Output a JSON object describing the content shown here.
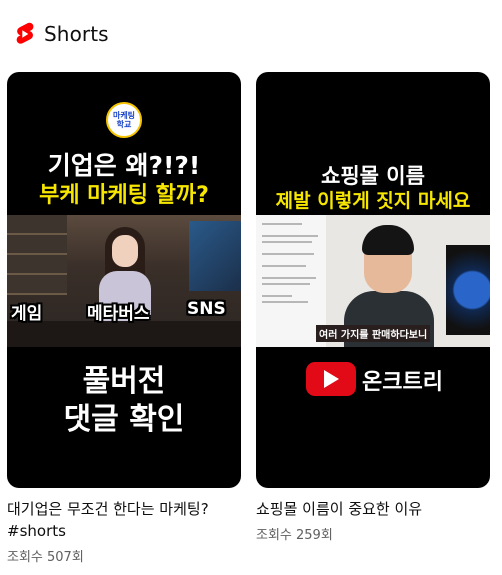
{
  "header": {
    "title": "Shorts",
    "logo_icon": "youtube-shorts-icon",
    "logo_color": "#ff0000"
  },
  "cards": [
    {
      "title": "대기업은 무조건 한다는 마케팅? #shorts",
      "views": "조회수 507회",
      "thumbnail": {
        "badge_line1": "마케팅",
        "badge_line2": "학교",
        "headline1": "기업은 왜?!?!",
        "headline2": "부케 마케팅 할까?",
        "tag_game": "게임",
        "tag_metaverse": "메타버스",
        "tag_sns": "SNS",
        "bottom1": "풀버전",
        "bottom2": "댓글 확인",
        "headline2_color": "#f7e600"
      }
    },
    {
      "title": "쇼핑몰 이름이 중요한 이유",
      "views": "조회수 259회",
      "thumbnail": {
        "headline1": "쇼핑몰 이름",
        "headline2": "제발 이렇게 짓지 마세요",
        "caption": "여러 가지를 판매하다보니",
        "brand": "온크트리",
        "headline2_color": "#f7e600"
      }
    }
  ]
}
